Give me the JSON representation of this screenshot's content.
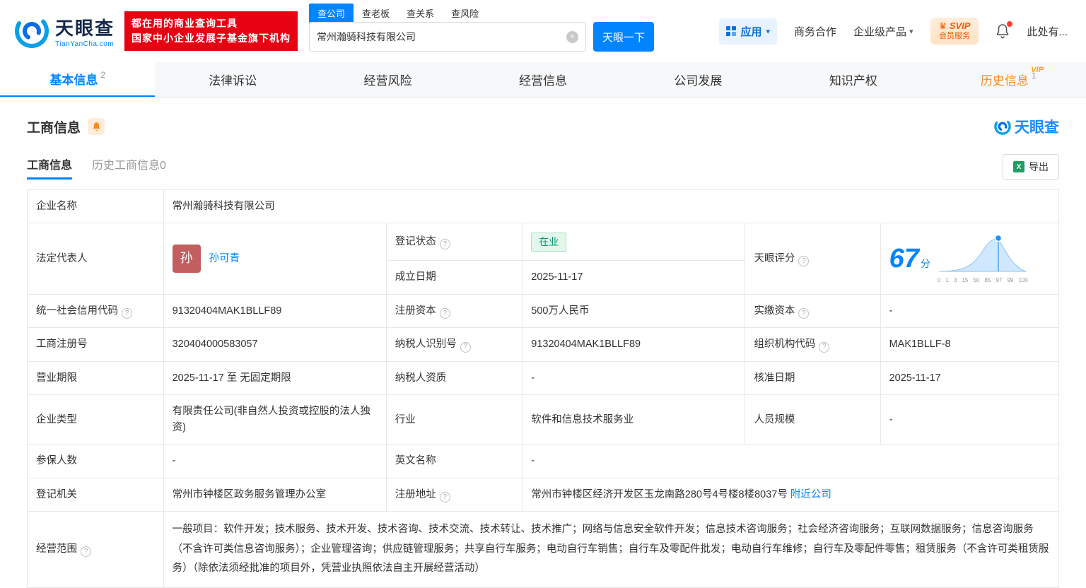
{
  "icons": {
    "question": "?",
    "caret": "▾",
    "close": "×",
    "excel_x": "X",
    "crown": "♛"
  },
  "header": {
    "logo": {
      "brand": "天眼查",
      "domain": "TianYanCha.com"
    },
    "slogan": {
      "line1": "都在用的商业查询工具",
      "line2": "国家中小企业发展子基金旗下机构"
    },
    "search_tabs": [
      {
        "label": "查公司"
      },
      {
        "label": "查老板"
      },
      {
        "label": "查关系"
      },
      {
        "label": "查风险"
      }
    ],
    "search": {
      "value": "常州瀚骑科技有限公司",
      "button": "天眼一下"
    },
    "right_menu": {
      "apps": "应用",
      "cooperation": "商务合作",
      "enterprise": "企业级产品",
      "svip_line1": "SVIP",
      "svip_line2": "会员服务",
      "more": "此处有..."
    }
  },
  "nav_tabs": [
    {
      "label": "基本信息",
      "badge": "2"
    },
    {
      "label": "法律诉讼"
    },
    {
      "label": "经营风险"
    },
    {
      "label": "经营信息"
    },
    {
      "label": "公司发展"
    },
    {
      "label": "知识产权"
    },
    {
      "label": "历史信息",
      "badge": "1",
      "vip": "VIP"
    }
  ],
  "section": {
    "title": "工商信息",
    "watermark": "天眼查",
    "tabs": [
      {
        "label": "工商信息"
      },
      {
        "label": "历史工商信息0"
      }
    ],
    "export_label": "导出"
  },
  "fields": {
    "company_name": {
      "label": "企业名称",
      "value": "常州瀚骑科技有限公司"
    },
    "legal_rep": {
      "label": "法定代表人",
      "value": "孙可青",
      "avatar": "孙"
    },
    "reg_status": {
      "label": "登记状态",
      "value": "在业"
    },
    "establish_date": {
      "label": "成立日期",
      "value": "2025-11-17"
    },
    "score": {
      "label": "天眼评分",
      "value": "67",
      "unit": "分",
      "axis": [
        "0",
        "1",
        "3",
        "15",
        "50",
        "85",
        "97",
        "99",
        "100"
      ]
    },
    "credit_code": {
      "label": "统一社会信用代码",
      "value": "91320404MAK1BLLF89"
    },
    "reg_capital": {
      "label": "注册资本",
      "value": "500万人民币"
    },
    "paid_capital": {
      "label": "实缴资本",
      "value": "-"
    },
    "reg_number": {
      "label": "工商注册号",
      "value": "320404000583057"
    },
    "taxpayer_id": {
      "label": "纳税人识别号",
      "value": "91320404MAK1BLLF89"
    },
    "org_code": {
      "label": "组织机构代码",
      "value": "MAK1BLLF-8"
    },
    "business_term": {
      "label": "营业期限",
      "value": "2025-11-17 至 无固定期限"
    },
    "taxpayer_quality": {
      "label": "纳税人资质",
      "value": "-"
    },
    "approval_date": {
      "label": "核准日期",
      "value": "2025-11-17"
    },
    "company_type": {
      "label": "企业类型",
      "value": "有限责任公司(非自然人投资或控股的法人独资)"
    },
    "industry": {
      "label": "行业",
      "value": "软件和信息技术服务业"
    },
    "staff_size": {
      "label": "人员规模",
      "value": "-"
    },
    "insured_count": {
      "label": "参保人数",
      "value": "-"
    },
    "english_name": {
      "label": "英文名称",
      "value": "-"
    },
    "reg_authority": {
      "label": "登记机关",
      "value": "常州市钟楼区政务服务管理办公室"
    },
    "reg_address": {
      "label": "注册地址",
      "value": "常州市钟楼区经济开发区玉龙南路280号4号楼8楼8037号",
      "link": "附近公司"
    },
    "business_scope": {
      "label": "经营范围",
      "value": "一般项目：软件开发；技术服务、技术开发、技术咨询、技术交流、技术转让、技术推广；网络与信息安全软件开发；信息技术咨询服务；社会经济咨询服务；互联网数据服务；信息咨询服务（不含许可类信息咨询服务）；企业管理咨询；供应链管理服务；共享自行车服务；电动自行车销售；自行车及零配件批发；电动自行车维修；自行车及零配件零售；租赁服务（不含许可类租赁服务）（除依法须经批准的项目外，凭营业执照依法自主开展经营活动）"
    }
  }
}
